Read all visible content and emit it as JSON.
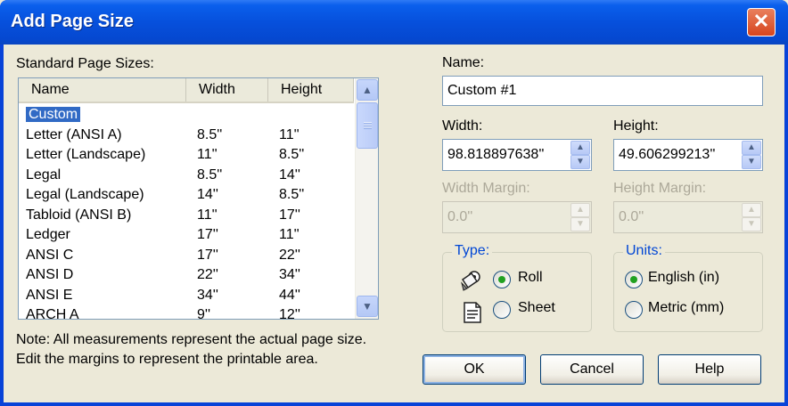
{
  "window": {
    "title": "Add Page Size",
    "close_glyph": "✕"
  },
  "left": {
    "list_label": "Standard Page Sizes:",
    "columns": [
      "Name",
      "Width",
      "Height"
    ],
    "rows": [
      {
        "name": "Custom",
        "width": "",
        "height": "",
        "selected": true
      },
      {
        "name": "Letter (ANSI A)",
        "width": "8.5''",
        "height": "11''"
      },
      {
        "name": "Letter (Landscape)",
        "width": "11''",
        "height": "8.5''"
      },
      {
        "name": "Legal",
        "width": "8.5''",
        "height": "14''"
      },
      {
        "name": "Legal (Landscape)",
        "width": "14''",
        "height": "8.5''"
      },
      {
        "name": "Tabloid (ANSI B)",
        "width": "11''",
        "height": "17''"
      },
      {
        "name": "Ledger",
        "width": "17''",
        "height": "11''"
      },
      {
        "name": "ANSI C",
        "width": "17''",
        "height": "22''"
      },
      {
        "name": "ANSI D",
        "width": "22''",
        "height": "34''"
      },
      {
        "name": "ANSI E",
        "width": "34''",
        "height": "44''"
      },
      {
        "name": "ARCH A",
        "width": "9''",
        "height": "12''"
      }
    ],
    "note_line1": "Note:  All measurements represent the actual page size.",
    "note_line2": "Edit the margins to represent the printable area."
  },
  "right": {
    "name_label": "Name:",
    "name_value": "Custom #1",
    "width_label": "Width:",
    "width_value": "98.818897638''",
    "height_label": "Height:",
    "height_value": "49.606299213''",
    "width_margin_label": "Width Margin:",
    "width_margin_value": "0.0''",
    "height_margin_label": "Height Margin:",
    "height_margin_value": "0.0''",
    "type_group": {
      "title": "Type:",
      "roll": "Roll",
      "sheet": "Sheet",
      "selected": "Roll"
    },
    "units_group": {
      "title": "Units:",
      "english": "English (in)",
      "metric": "Metric (mm)",
      "selected": "English (in)"
    }
  },
  "buttons": {
    "ok": "OK",
    "cancel": "Cancel",
    "help": "Help"
  },
  "icons": {
    "scroll_up": "▲",
    "scroll_down": "▼",
    "spin_up": "▲",
    "spin_down": "▼",
    "roll": "roll-media-icon",
    "sheet": "sheet-media-icon"
  }
}
